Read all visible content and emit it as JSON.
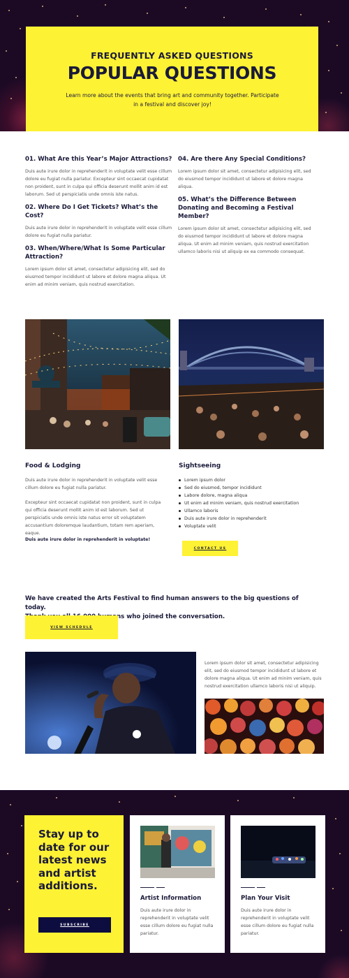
{
  "hero": {
    "eyebrow": "FREQUENTLY ASKED QUESTIONS",
    "title": "POPULAR QUESTIONS",
    "subtitle": "Learn more about the events that bring art and community together. Participate in a festival and discover joy!"
  },
  "faq": {
    "left": [
      {
        "q": "01. What Are this Year’s Major Attractions?",
        "a": "Duis aute irure dolor in reprehenderit in voluptate velit esse cillum dolore eu fugiat nulla pariatur. Excepteur sint occaecat cupidatat non proident, sunt in culpa qui officia deserunt mollit anim id est laborum. Sed ut perspiciatis unde omnis iste natus."
      },
      {
        "q": "02. Where Do I Get Tickets? What’s the Cost?",
        "a": "Duis aute irure dolor in reprehenderit in voluptate velit esse cillum dolore eu fugiat nulla pariatur."
      },
      {
        "q": "03. When/Where/What Is Some Particular Attraction?",
        "a": "Lorem ipsum dolor sit amet, consectetur adipisicing elit, sed do eiusmod tempor incididunt ut labore et dolore magna aliqua. Ut enim ad minim veniam, quis nostrud exercitation."
      }
    ],
    "right": [
      {
        "q": "04. Are there Any Special Conditions?",
        "a": "Lorem ipsum dolor sit amet, consectetur adipisicing elit, sed do eiusmod tempor incididunt ut labore et dolore magna aliqua."
      },
      {
        "q": "05. What’s the Difference Between Donating and Becoming a Festival Member?",
        "a": "Lorem ipsum dolor sit amet, consectetur adipisicing elit, sed do eiusmod tempor incididunt ut labore et dolore magna aliqua. Ut enim ad minim veniam, quis nostrud exercitation ullamco laboris nisi ut aliquip ex ea commodo consequat."
      }
    ]
  },
  "food": {
    "title": "Food & Lodging",
    "p1": "Duis aute irure dolor in reprehenderit in voluptate velit esse cillum dolore eu fugiat nulla pariatur.",
    "p2": "Excepteur sint occaecat cupidatat non proident, sunt in culpa qui officia deserunt mollit anim id est laborum. Sed ut perspiciatis unde omnis iste natus error sit voluptatem accusantium doloremque laudantium, totam rem aperiam, eaque.",
    "bold": "Duis aute irure dolor in reprehenderit in voluptate!"
  },
  "sightseeing": {
    "title": "Sightseeing",
    "items": [
      "Lorem ipsum dolor",
      "Sed do eiusmod, tempor incididunt",
      "Labore dolore, magna aliqua",
      "Ut enim ad minim veniam, quis nostrud exercitation",
      "Ullamco laboris",
      "Duis aute irure dolor in reprehenderit",
      "Voluptate velit"
    ],
    "button": "CONTACT US"
  },
  "statement": {
    "line1": "We have created the Arts Festival to find human answers to the big questions of today.",
    "line2": "Thank you all 16,000 humans who joined the conversation.",
    "button": "VIEW SCHEDULE"
  },
  "performer": {
    "text": "Lorem ipsum dolor sit amet, consectetur adipisicing elit, sed do eiusmod tempor incididunt ut labore et dolore magna aliqua. Ut enim ad minim veniam, quis nostrud exercitation ullamco laboris nisi ut aliquip."
  },
  "footer": {
    "subscribe_title": "Stay up to date for our latest news and artist additions.",
    "subscribe_button": "SUBSCRIBE",
    "cards": [
      {
        "title": "Artist Information",
        "text": "Duis aute irure dolor in reprehenderit in voluptate velit esse cillum dolore eu fugiat nulla pariatur."
      },
      {
        "title": "Plan Your Visit",
        "text": "Duis aute irure dolor in reprehenderit in voluptate velit esse cillum dolore eu fugiat nulla pariatur."
      }
    ]
  },
  "colors": {
    "accent_yellow": "#fef234",
    "navy": "#1a1a3a",
    "night_bg": "#1c0a25"
  }
}
